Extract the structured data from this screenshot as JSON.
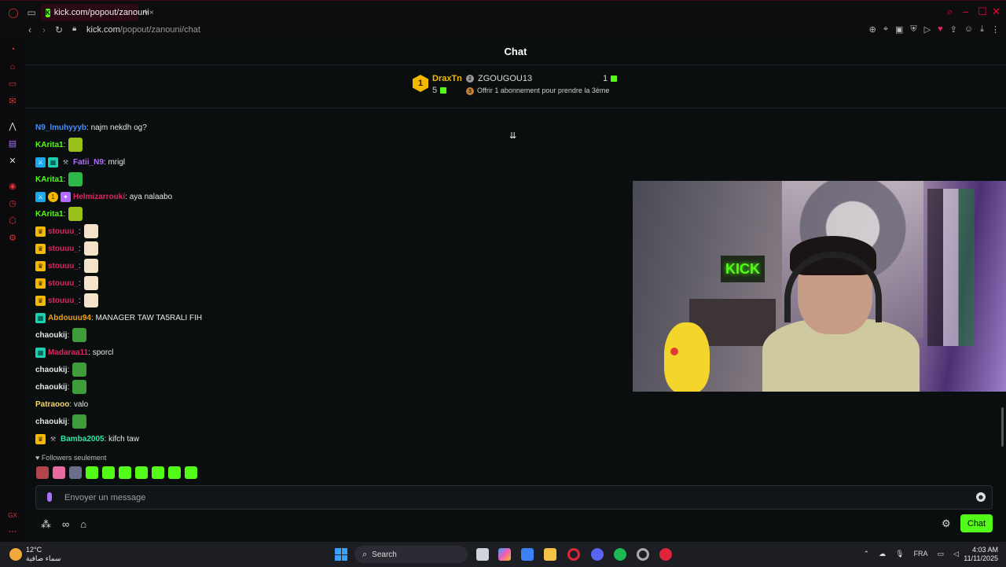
{
  "browser": {
    "tab_title": "kick.com/popout/zanouni",
    "tab_close": "×",
    "new_tab": "+",
    "url_host": "kick.com",
    "url_path": "/popout/zanouni/chat"
  },
  "chat": {
    "header": "Chat",
    "leaderboard": {
      "first": {
        "rank": "1",
        "name": "DraxTn",
        "count": "5"
      },
      "second": {
        "rank": "2",
        "name": "ZGOUGOU13",
        "count": "1"
      },
      "third": {
        "rank": "3",
        "offer": "Offrir 1 abonnement pour prendre la 3ème"
      }
    },
    "scroll_icon": "⇊",
    "messages": [
      {
        "badges": [],
        "user": "N9_lmuhyyyb",
        "color": "#4a8dff",
        "text": ": najm nekdh og?",
        "emote": null
      },
      {
        "badges": [],
        "user": "KArita1",
        "color": "#53fc18",
        "text": ":",
        "emote": "#9bbf1a"
      },
      {
        "badges": [
          "vip",
          "grid",
          "mod"
        ],
        "user": "Fatii_N9",
        "color": "#b36bff",
        "text": ": mrigl",
        "emote": null
      },
      {
        "badges": [],
        "user": "KArita1",
        "color": "#53fc18",
        "text": ":",
        "emote": "#2fb84a"
      },
      {
        "badges": [
          "vip",
          "one",
          "gift"
        ],
        "user": "Helmizarrouki",
        "color": "#e0245e",
        "text": ": aya nalaabo",
        "emote": null
      },
      {
        "badges": [],
        "user": "KArita1",
        "color": "#53fc18",
        "text": ":",
        "emote": "#9bbf1a"
      },
      {
        "badges": [
          "crown"
        ],
        "user": "stouuu_",
        "color": "#e0245e",
        "text": ":",
        "emote": "#f4e3c8"
      },
      {
        "badges": [
          "crown"
        ],
        "user": "stouuu_",
        "color": "#e0245e",
        "text": ":",
        "emote": "#f4e3c8"
      },
      {
        "badges": [
          "crown"
        ],
        "user": "stouuu_",
        "color": "#e0245e",
        "text": ":",
        "emote": "#f4e3c8"
      },
      {
        "badges": [
          "crown"
        ],
        "user": "stouuu_",
        "color": "#e0245e",
        "text": ":",
        "emote": "#f4e3c8"
      },
      {
        "badges": [
          "crown"
        ],
        "user": "stouuu_",
        "color": "#e0245e",
        "text": ":",
        "emote": "#f4e3c8"
      },
      {
        "badges": [
          "grid"
        ],
        "user": "Abdouuu94",
        "color": "#f59e0b",
        "text": ": MANAGER TAW TA5RALI FIH",
        "emote": null
      },
      {
        "badges": [],
        "user": "chaoukij",
        "color": "#e6e6e6",
        "text": ":",
        "emote": "#3f9c3a"
      },
      {
        "badges": [
          "grid"
        ],
        "user": "Madaraa11",
        "color": "#e0245e",
        "text": ": sporcl",
        "emote": null
      },
      {
        "badges": [],
        "user": "chaoukij",
        "color": "#e6e6e6",
        "text": ":",
        "emote": "#3f9c3a"
      },
      {
        "badges": [],
        "user": "chaoukij",
        "color": "#e6e6e6",
        "text": ":",
        "emote": "#3f9c3a"
      },
      {
        "badges": [],
        "user": "Patraooo",
        "color": "#f5d66b",
        "text": ": valo",
        "emote": null
      },
      {
        "badges": [],
        "user": "chaoukij",
        "color": "#e6e6e6",
        "text": ":",
        "emote": "#3f9c3a"
      },
      {
        "badges": [
          "crown",
          "mod"
        ],
        "user": "Bamba2005",
        "color": "#2ee6a6",
        "text": ": kifch taw",
        "emote": null
      }
    ],
    "followers_only": "Followers seulement",
    "input_placeholder": "Envoyer un message",
    "send_button": "Chat",
    "emote_tray_colors": [
      "#b3444a",
      "#e86aa0",
      "#6b6b8a",
      "#53fc18",
      "#53fc18",
      "#53fc18",
      "#53fc18",
      "#53fc18",
      "#53fc18",
      "#53fc18"
    ]
  },
  "video": {
    "neon_sign": "KICK"
  },
  "taskbar": {
    "temperature": "12°C",
    "weather": "سماء صافية",
    "search": "Search",
    "language": "FRA",
    "time": "4:03 AM",
    "date": "11/11/2025"
  },
  "colors": {
    "accent": "#53fc18",
    "opera_red": "#e0243a"
  }
}
